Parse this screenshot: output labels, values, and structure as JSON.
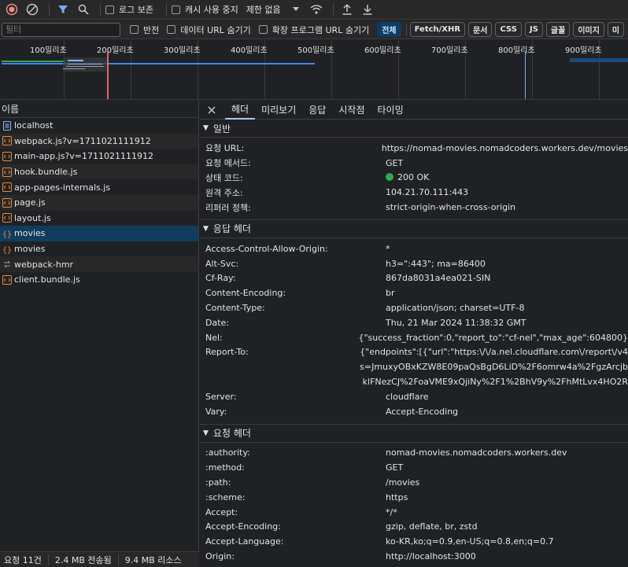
{
  "toolbar": {
    "preserve_log": "로그 보존",
    "disable_cache": "캐시 사용 중지",
    "throttle": "제한 없음"
  },
  "filterbar": {
    "placeholder": "필터",
    "invert": "반전",
    "hide_data_urls": "데이터 URL 숨기기",
    "hide_ext_urls": "확장 프로그램 URL 숨기기",
    "types": [
      "전체",
      "Fetch/XHR",
      "문서",
      "CSS",
      "JS",
      "글꼴",
      "이미지",
      "미"
    ]
  },
  "timeline": {
    "ticks": [
      "100밀리초",
      "200밀리초",
      "300밀리초",
      "400밀리초",
      "500밀리초",
      "600밀리초",
      "700밀리초",
      "800밀리초",
      "900밀리초"
    ]
  },
  "requests": {
    "header": "이름",
    "items": [
      {
        "name": "localhost",
        "type": "doc"
      },
      {
        "name": "webpack.js?v=1711021111912",
        "type": "script"
      },
      {
        "name": "main-app.js?v=1711021111912",
        "type": "script"
      },
      {
        "name": "hook.bundle.js",
        "type": "script"
      },
      {
        "name": "app-pages-internals.js",
        "type": "script"
      },
      {
        "name": "page.js",
        "type": "script"
      },
      {
        "name": "layout.js",
        "type": "script"
      },
      {
        "name": "movies",
        "type": "fetch"
      },
      {
        "name": "movies",
        "type": "fetch"
      },
      {
        "name": "webpack-hmr",
        "type": "ws"
      },
      {
        "name": "client.bundle.js",
        "type": "script"
      }
    ],
    "selected_index": 7
  },
  "status": {
    "requests": "요청 11건",
    "transferred": "2.4 MB 전송됨",
    "resources": "9.4 MB 리소스"
  },
  "detail": {
    "tabs": [
      "헤더",
      "미리보기",
      "응답",
      "시작점",
      "타이밍"
    ],
    "general": {
      "title": "일반",
      "rows": [
        {
          "k": "요청 URL:",
          "v": "https://nomad-movies.nomadcoders.workers.dev/movies"
        },
        {
          "k": "요청 메서드:",
          "v": "GET"
        },
        {
          "k": "상태 코드:",
          "v": "200 OK"
        },
        {
          "k": "원격 주소:",
          "v": "104.21.70.111:443"
        },
        {
          "k": "리퍼러 정책:",
          "v": "strict-origin-when-cross-origin"
        }
      ]
    },
    "response_headers": {
      "title": "응답 헤더",
      "rows": [
        {
          "k": "Access-Control-Allow-Origin:",
          "v": "*"
        },
        {
          "k": "Alt-Svc:",
          "v": "h3=\":443\"; ma=86400"
        },
        {
          "k": "Cf-Ray:",
          "v": "867da8031a4ea021-SIN"
        },
        {
          "k": "Content-Encoding:",
          "v": "br"
        },
        {
          "k": "Content-Type:",
          "v": "application/json; charset=UTF-8"
        },
        {
          "k": "Date:",
          "v": "Thu, 21 Mar 2024 11:38:32 GMT"
        },
        {
          "k": "Nel:",
          "v": "{\"success_fraction\":0,\"report_to\":\"cf-nel\",\"max_age\":604800}"
        },
        {
          "k": "Report-To:",
          "v": "{\"endpoints\":[{\"url\":\"https:\\/\\/a.nel.cloudflare.com\\/report\\/v4"
        },
        {
          "k": "",
          "v": "s=JmuxyOBxKZW8E09paQsBgD6LiD%2F6omrw4a%2FgzArcjb"
        },
        {
          "k": "",
          "v": "klFNezCJ%2FoaVME9xQjiNy%2F1%2BhV9y%2FhMtLvx4HO2R"
        },
        {
          "k": "Server:",
          "v": "cloudflare"
        },
        {
          "k": "Vary:",
          "v": "Accept-Encoding"
        }
      ]
    },
    "request_headers": {
      "title": "요청 헤더",
      "rows": [
        {
          "k": ":authority:",
          "v": "nomad-movies.nomadcoders.workers.dev"
        },
        {
          "k": ":method:",
          "v": "GET"
        },
        {
          "k": ":path:",
          "v": "/movies"
        },
        {
          "k": ":scheme:",
          "v": "https"
        },
        {
          "k": "Accept:",
          "v": "*/*"
        },
        {
          "k": "Accept-Encoding:",
          "v": "gzip, deflate, br, zstd"
        },
        {
          "k": "Accept-Language:",
          "v": "ko-KR,ko;q=0.9,en-US;q=0.8,en;q=0.7"
        },
        {
          "k": "Origin:",
          "v": "http://localhost:3000"
        }
      ]
    }
  },
  "colors": {
    "record_red": "#f28b82",
    "accent_blue": "#a8c7fa",
    "selected_row": "#103d5d",
    "status_green": "#34a853"
  }
}
